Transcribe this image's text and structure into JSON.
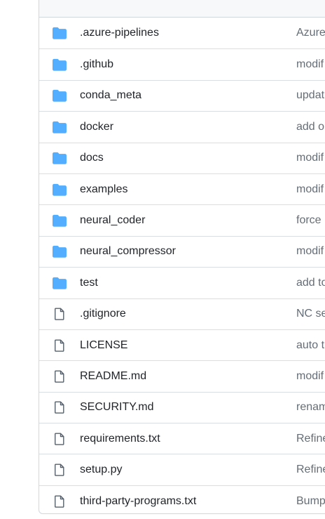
{
  "colors": {
    "folder_icon": "#54aeff",
    "file_icon": "#57606a",
    "name_text": "#1f2328",
    "commit_text": "#656d76",
    "border": "#d0d7de",
    "header_bg": "#f6f8fa"
  },
  "files": [
    {
      "name": ".azure-pipelines",
      "type": "folder",
      "icon": "folder-icon",
      "commit": "Azure"
    },
    {
      "name": ".github",
      "type": "folder",
      "icon": "folder-icon",
      "commit": "modif"
    },
    {
      "name": "conda_meta",
      "type": "folder",
      "icon": "folder-icon",
      "commit": "updat"
    },
    {
      "name": "docker",
      "type": "folder",
      "icon": "folder-icon",
      "commit": "add o"
    },
    {
      "name": "docs",
      "type": "folder",
      "icon": "folder-icon",
      "commit": "modif"
    },
    {
      "name": "examples",
      "type": "folder",
      "icon": "folder-icon",
      "commit": "modif"
    },
    {
      "name": "neural_coder",
      "type": "folder",
      "icon": "folder-icon",
      "commit": "force"
    },
    {
      "name": "neural_compressor",
      "type": "folder",
      "icon": "folder-icon",
      "commit": "modif"
    },
    {
      "name": "test",
      "type": "folder",
      "icon": "folder-icon",
      "commit": "add to"
    },
    {
      "name": ".gitignore",
      "type": "file",
      "icon": "file-icon",
      "commit": "NC se"
    },
    {
      "name": "LICENSE",
      "type": "file",
      "icon": "file-icon",
      "commit": "auto t"
    },
    {
      "name": "README.md",
      "type": "file",
      "icon": "file-icon",
      "commit": "modif"
    },
    {
      "name": "SECURITY.md",
      "type": "file",
      "icon": "file-icon",
      "commit": "renam"
    },
    {
      "name": "requirements.txt",
      "type": "file",
      "icon": "file-icon",
      "commit": "Refine"
    },
    {
      "name": "setup.py",
      "type": "file",
      "icon": "file-icon",
      "commit": "Refine"
    },
    {
      "name": "third-party-programs.txt",
      "type": "file",
      "icon": "file-icon",
      "commit": "Bump"
    }
  ]
}
